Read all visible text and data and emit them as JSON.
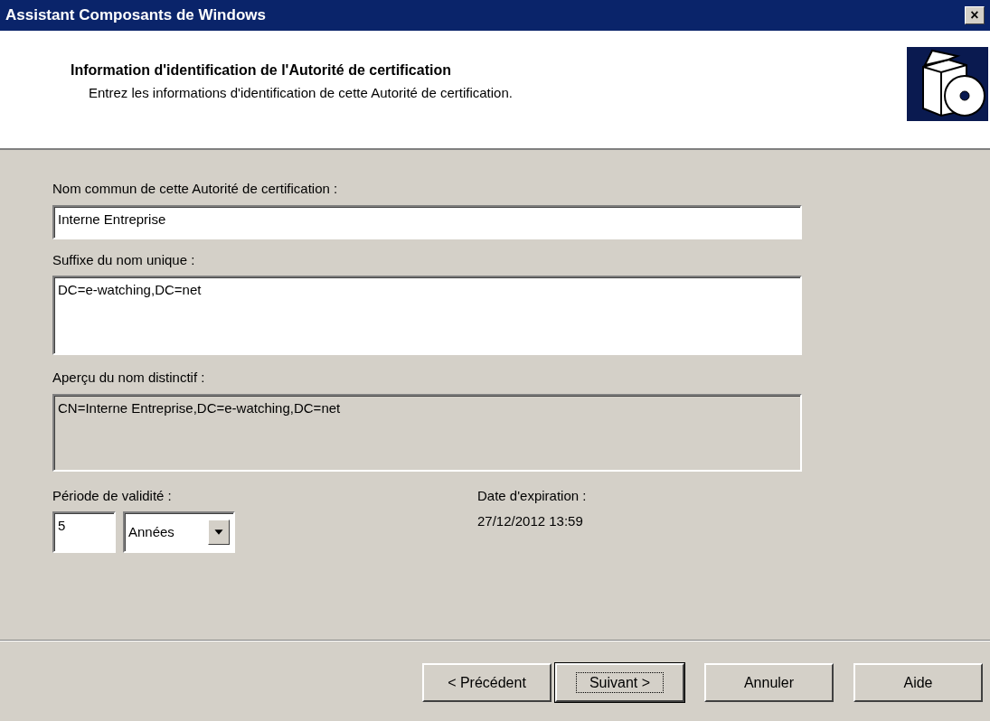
{
  "window": {
    "title": "Assistant Composants de Windows",
    "close": "×"
  },
  "header": {
    "title": "Information d'identification de l'Autorité de certification",
    "subtitle": "Entrez les informations d'identification de cette Autorité de certification."
  },
  "fields": [
    {
      "kind": "input",
      "label": "Nom commun de cette Autorité de certification :",
      "value": "Interne Entreprise"
    },
    {
      "kind": "textarea",
      "label": "Suffixe du nom unique :",
      "value": "DC=e-watching,DC=net"
    },
    {
      "kind": "readonly",
      "label": "Aperçu du nom distinctif :",
      "value": "CN=Interne Entreprise,DC=e-watching,DC=net"
    }
  ],
  "validity": {
    "label": "Période de validité :",
    "value": "5",
    "unit": "Années"
  },
  "expiration": {
    "label": "Date d'expiration :",
    "value": "27/12/2012 13:59"
  },
  "buttons": [
    {
      "label": "< Précédent",
      "default": false
    },
    {
      "label": "Suivant >",
      "default": true
    },
    {
      "label": "Annuler",
      "default": false
    },
    {
      "label": "Aide",
      "default": false
    }
  ]
}
